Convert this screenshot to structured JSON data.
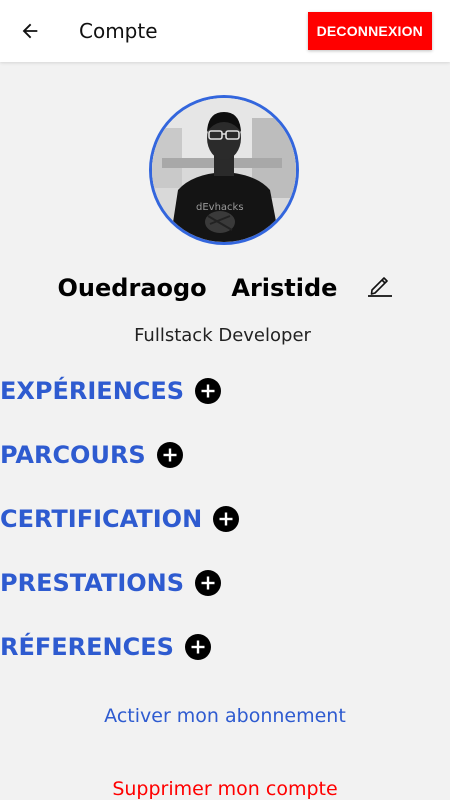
{
  "appbar": {
    "title": "Compte",
    "back_icon": "arrow-left-icon",
    "logout_label": "DECONNEXION"
  },
  "profile": {
    "name": "Ouedraogo  Aristide",
    "role": "Fullstack Developer",
    "edit_icon": "pencil-icon"
  },
  "sections": [
    {
      "label": "EXPÉRIENCES",
      "icon": "add-circle-icon"
    },
    {
      "label": "PARCOURS",
      "icon": "add-circle-icon"
    },
    {
      "label": "CERTIFICATION",
      "icon": "add-circle-icon"
    },
    {
      "label": "PRESTATIONS",
      "icon": "add-circle-icon"
    },
    {
      "label": "RÉFERENCES",
      "icon": "add-circle-icon"
    }
  ],
  "links": {
    "subscribe": "Activer mon abonnement",
    "delete_account": "Supprimer mon compte"
  },
  "colors": {
    "accent": "#2e5bd0",
    "danger": "#ff0000",
    "background": "#f2f2f2",
    "appbar": "#ffffff",
    "avatar_border": "#3366dd"
  }
}
